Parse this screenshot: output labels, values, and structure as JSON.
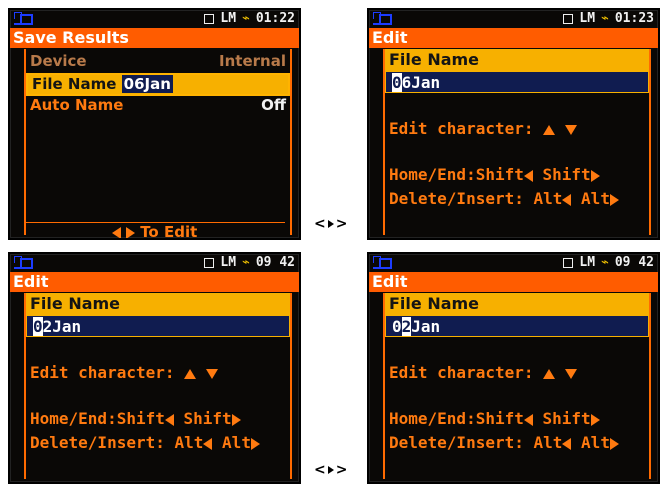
{
  "status": {
    "mem_label": "LM",
    "time_1": "01:22",
    "time_2": "01:23",
    "time_3": "09 42",
    "time_4": "09 42"
  },
  "colors": {
    "title": "#ff5c00",
    "accent": "#ff7a10",
    "selection": "#f7b000",
    "edit_bg": "#101c50",
    "battery": "#f0c000"
  },
  "screen1": {
    "title": "Save Results",
    "rows": [
      {
        "label": "Device",
        "value": "Internal"
      },
      {
        "label": "File Name",
        "value": "06Jan"
      },
      {
        "label": "Auto Name",
        "value": "Off"
      }
    ],
    "hint": "To Edit"
  },
  "edit_screens": [
    {
      "title": "Edit",
      "field_label": "File Name",
      "cursor_char": "0",
      "rest": "6Jan",
      "line1": "Edit character:",
      "line2": "Home/End:Shift",
      "line2b": "Shift",
      "line3": "Delete/Insert:",
      "line3a": "Alt",
      "line3b": "Alt"
    },
    {
      "title": "Edit",
      "field_label": "File Name",
      "cursor_char": "0",
      "rest": "2Jan",
      "line1": "Edit character:",
      "line2": "Home/End:Shift",
      "line2b": "Shift",
      "line3": "Delete/Insert:",
      "line3a": "Alt",
      "line3b": "Alt"
    },
    {
      "title": "Edit",
      "field_label": "File Name",
      "pre": "0",
      "cursor_char": "2",
      "rest": "Jan",
      "line1": "Edit character:",
      "line2": "Home/End:Shift",
      "line2b": "Shift",
      "line3": "Delete/Insert:",
      "line3a": "Alt",
      "line3b": "Alt"
    }
  ],
  "separators": {
    "left": "<",
    "right": ">"
  }
}
